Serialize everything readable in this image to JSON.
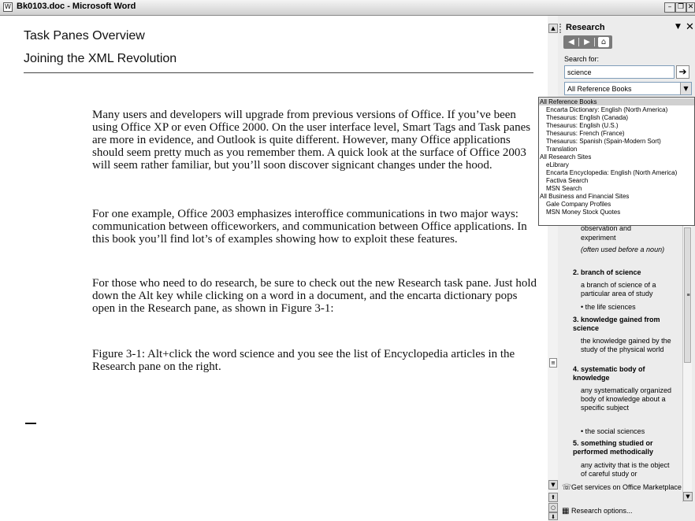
{
  "window": {
    "title": "Bk0103.doc - Microsoft Word",
    "minimize_glyph": "–",
    "restore_glyph": "❐",
    "close_glyph": "✕"
  },
  "document": {
    "heading1": "Task Panes Overview",
    "heading2": "Joining the XML Revolution",
    "paragraphs": [
      "Many users and developers will upgrade from previous versions of Office. If you’ve been using Office XP or even Office 2000. On the user interface level, Smart Tags and Task panes are more in evidence, and Outlook is quite different. However, many Office applications should seem pretty much as you remember them. A quick look at the surface of Office 2003 will seem rather familiar, but you’ll soon discover signicant changes under the hood.",
      "For one example, Office 2003 emphasizes interoffice communications in two major ways: communication between officeworkers, and communication between Office applications. In this book you’ll find lot’s of examples showing how to exploit these features.",
      "For those who need to do research, be sure to check out the new Research task pane. Just hold down the Alt key while clicking on a word in a document, and the encarta dictionary pops open in the Research pane, as shown in Figure 3-1:",
      "Figure 3-1: Alt+click the word science and you see the list of Encyclopedia articles in the Research pane on the right."
    ]
  },
  "research_pane": {
    "title": "Research",
    "dropdown_glyph": "▼",
    "close_glyph": "✕",
    "back_glyph": "◀",
    "forward_glyph": "▶",
    "home_glyph": "⌂",
    "search_label": "Search for:",
    "search_value": "science",
    "go_glyph": "➔",
    "selected_source": "All Reference Books",
    "select_arrow": "▼",
    "source_options": [
      "All Reference Books",
      "Encarta Dictionary: English (North America)",
      "Thesaurus: English (Canada)",
      "Thesaurus: English (U.S.)",
      "Thesaurus: French (France)",
      "Thesaurus: Spanish (Spain-Modern Sort)",
      "Translation",
      "All Research Sites",
      "eLibrary",
      "Encarta Encyclopedia: English (North America)",
      "Factiva Search",
      "MSN Search",
      "All Business and Financial Sites",
      "Gale Company Profiles",
      "MSN Money Stock Quotes"
    ],
    "results": {
      "partial_1": "observation and",
      "partial_2": "experiment",
      "note": "(often used before a noun)",
      "h2": "2. branch of science",
      "d2": "a branch of science of a particular area of study",
      "b2": "• the life sciences",
      "h3": "3. knowledge gained from science",
      "d3": "the knowledge gained by the study of the physical world",
      "h4": "4. systematic body of knowledge",
      "d4": "any systematically organized body of knowledge about a specific subject",
      "b4": "• the social sciences",
      "h5": "5. something studied or performed methodically",
      "d5": "any activity that is the object of careful study or"
    },
    "footer": {
      "marketplace": "Get services on Office Marketplace",
      "options": "Research options..."
    },
    "scroll_up_glyph": "▲",
    "scroll_down_glyph": "▼",
    "grip_glyph": "≡"
  }
}
